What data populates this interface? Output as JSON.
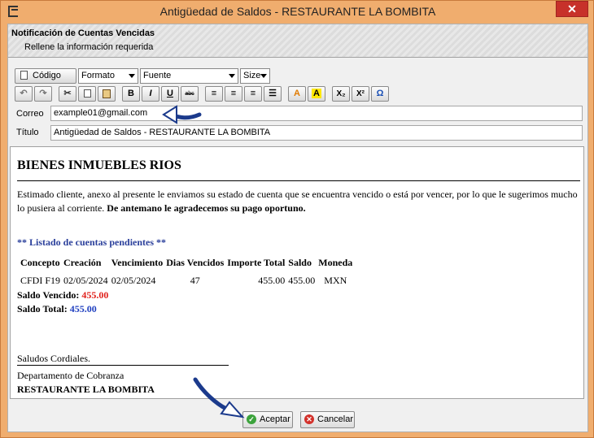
{
  "window": {
    "title": "Antigüedad de Saldos - RESTAURANTE LA BOMBITA",
    "close_label": "✕"
  },
  "header": {
    "title": "Notificación de Cuentas Vencidas",
    "subtitle": "Rellene la información requerida"
  },
  "toolbar": {
    "code_label": "Código",
    "format_value": "Formato",
    "font_value": "Fuente",
    "size_value": "Size",
    "bold": "B",
    "italic": "I",
    "underline": "U",
    "strike": "abc",
    "subscript": "X₂",
    "superscript": "X²",
    "omega": "Ω"
  },
  "form": {
    "email_label": "Correo",
    "email_value": "example01@gmail.com",
    "title_label": "Título",
    "title_value": "Antigüedad de Saldos - RESTAURANTE LA BOMBITA"
  },
  "body": {
    "heading": "BIENES INMUEBLES RIOS",
    "paragraph": "Estimado cliente, anexo al presente le enviamos su estado de cuenta que se encuentra vencido o está por vencer, por lo que le sugerimos mucho lo pusiera al corriente.",
    "paragraph_bold": "De antemano le agradecemos su pago oportuno.",
    "list_title": "** Listado de cuentas pendientes **",
    "columns": [
      "Concepto",
      "Creación",
      "Vencimiento",
      "Dias Vencidos",
      "Importe Total",
      "Saldo",
      "Moneda"
    ],
    "rows": [
      [
        "CFDI F19",
        "02/05/2024",
        "02/05/2024",
        "47",
        "455.00",
        "455.00",
        "MXN"
      ]
    ],
    "saldo_vencido_label": "Saldo Vencido:",
    "saldo_vencido_value": "455.00",
    "saldo_total_label": "Saldo Total:",
    "saldo_total_value": "455.00",
    "greeting": "Saludos Cordiales.",
    "department": "Departamento de Cobranza",
    "company": "RESTAURANTE LA BOMBITA"
  },
  "buttons": {
    "accept": "Aceptar",
    "cancel": "Cancelar"
  },
  "colors": {
    "window_frame": "#f0ad6e",
    "close": "#c7312a",
    "red_value": "#e0201b",
    "blue_value": "#2040c0",
    "list_title": "#2a3f9b"
  }
}
